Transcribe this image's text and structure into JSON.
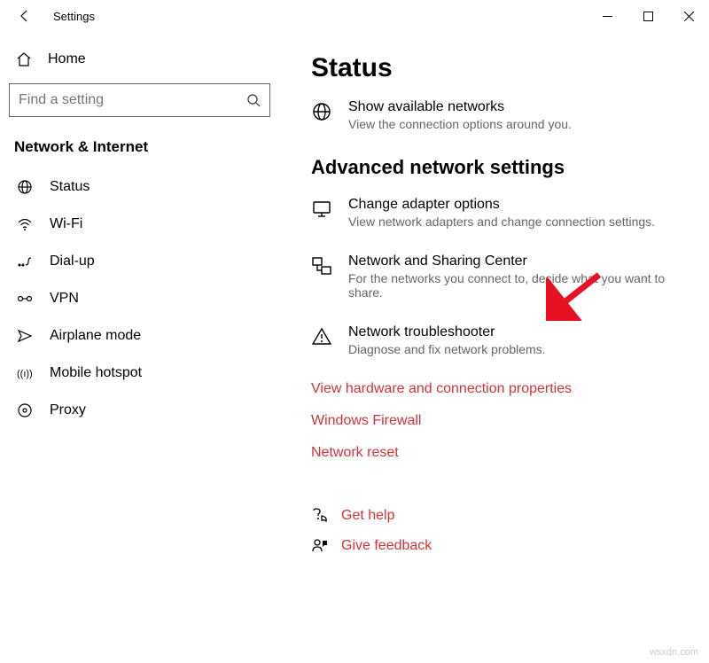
{
  "titlebar": {
    "title": "Settings"
  },
  "sidebar": {
    "home": "Home",
    "search_placeholder": "Find a setting",
    "category": "Network & Internet",
    "items": [
      {
        "label": "Status"
      },
      {
        "label": "Wi-Fi"
      },
      {
        "label": "Dial-up"
      },
      {
        "label": "VPN"
      },
      {
        "label": "Airplane mode"
      },
      {
        "label": "Mobile hotspot"
      },
      {
        "label": "Proxy"
      }
    ]
  },
  "main": {
    "page_title": "Status",
    "show_networks": {
      "title": "Show available networks",
      "desc": "View the connection options around you."
    },
    "advanced_heading": "Advanced network settings",
    "adapter": {
      "title": "Change adapter options",
      "desc": "View network adapters and change connection settings."
    },
    "sharing": {
      "title": "Network and Sharing Center",
      "desc": "For the networks you connect to, decide what you want to share."
    },
    "troubleshoot": {
      "title": "Network troubleshooter",
      "desc": "Diagnose and fix network problems."
    },
    "links": {
      "hardware": "View hardware and connection properties",
      "firewall": "Windows Firewall",
      "reset": "Network reset",
      "gethelp": "Get help",
      "feedback": "Give feedback"
    }
  },
  "watermark": "wsxdn.com"
}
